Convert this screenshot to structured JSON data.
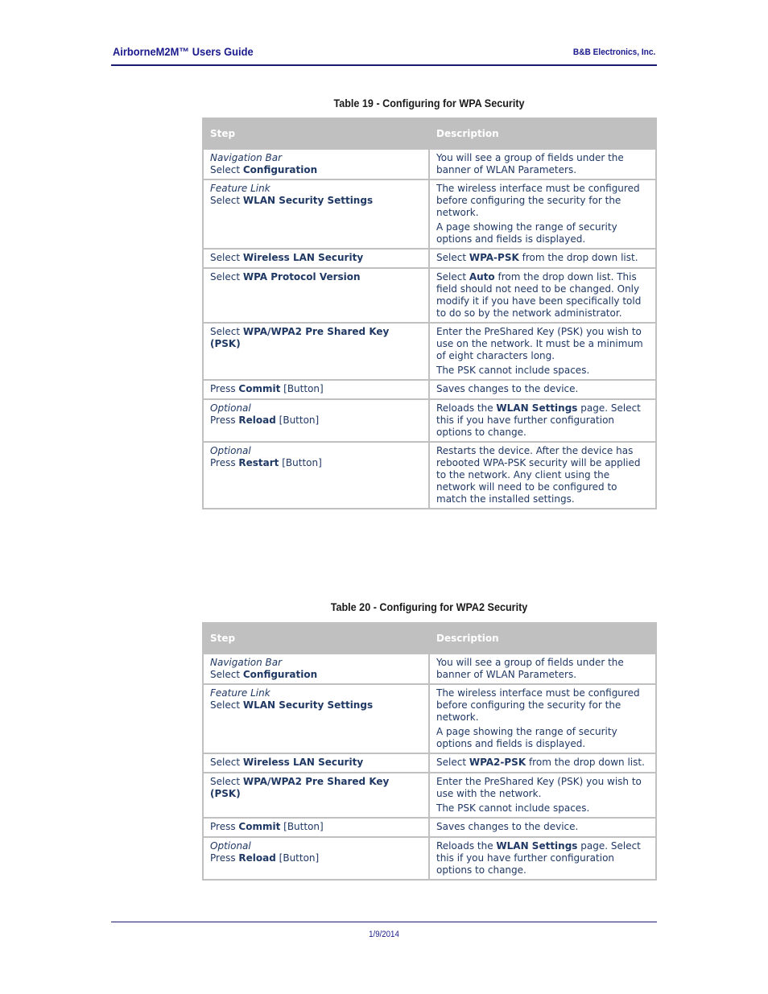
{
  "header": {
    "title": "AirborneM2M™ Users Guide",
    "company": "B&B Electronics, Inc."
  },
  "tables": [
    {
      "caption": "Table 19 - Configuring for WPA Security",
      "columns": [
        "Step",
        "Description"
      ],
      "rows": [
        {
          "step_context": "Navigation Bar",
          "step_prefix": "Select ",
          "step_bold": "Configuration",
          "step_suffix": "",
          "desc": [
            {
              "pre": "You will see a group of fields under the banner of WLAN Parameters.",
              "bold": "",
              "post": ""
            }
          ]
        },
        {
          "step_context": "Feature Link",
          "step_prefix": "Select ",
          "step_bold": "WLAN Security Settings",
          "step_suffix": "",
          "desc": [
            {
              "pre": "The wireless interface must be configured before configuring the security for the network.",
              "bold": "",
              "post": ""
            },
            {
              "pre": "A page showing the range of security options and fields is displayed.",
              "bold": "",
              "post": ""
            }
          ]
        },
        {
          "step_context": "",
          "step_prefix": "Select ",
          "step_bold": "Wireless LAN Security",
          "step_suffix": "",
          "desc": [
            {
              "pre": "Select ",
              "bold": "WPA-PSK",
              "post": " from the drop down list."
            }
          ]
        },
        {
          "step_context": "",
          "step_prefix": "Select ",
          "step_bold": "WPA Protocol Version",
          "step_suffix": "",
          "desc": [
            {
              "pre": "Select ",
              "bold": "Auto",
              "post": " from the drop down list. This field should not need to be changed. Only modify it if you have been specifically told to do so by the network administrator."
            }
          ]
        },
        {
          "step_context": "",
          "step_prefix": "Select ",
          "step_bold": "WPA/WPA2 Pre Shared Key (PSK)",
          "step_suffix": "",
          "desc": [
            {
              "pre": "Enter the PreShared Key (PSK) you wish to use on the network. It must be a minimum of eight characters long.",
              "bold": "",
              "post": ""
            },
            {
              "pre": "The PSK cannot include spaces.",
              "bold": "",
              "post": ""
            }
          ]
        },
        {
          "step_context": "",
          "step_prefix": "Press ",
          "step_bold": "Commit",
          "step_suffix": " [Button]",
          "desc": [
            {
              "pre": "Saves changes to the device.",
              "bold": "",
              "post": ""
            }
          ]
        },
        {
          "step_context": "Optional",
          "step_prefix": "Press ",
          "step_bold": "Reload",
          "step_suffix": " [Button]",
          "desc": [
            {
              "pre": "Reloads the ",
              "bold": "WLAN Settings",
              "post": " page. Select this if you have further configuration options to change."
            }
          ]
        },
        {
          "step_context": "Optional",
          "step_prefix": "Press ",
          "step_bold": "Restart",
          "step_suffix": " [Button]",
          "desc": [
            {
              "pre": "Restarts the device. After the device has rebooted WPA-PSK security will be applied to the network. Any client using the network will need to be configured to match the installed settings.",
              "bold": "",
              "post": ""
            }
          ]
        }
      ]
    },
    {
      "caption": "Table 20 - Configuring for WPA2 Security",
      "columns": [
        "Step",
        "Description"
      ],
      "rows": [
        {
          "step_context": "Navigation Bar",
          "step_prefix": "Select ",
          "step_bold": "Configuration",
          "step_suffix": "",
          "desc": [
            {
              "pre": "You will see a group of fields under the banner of WLAN Parameters.",
              "bold": "",
              "post": ""
            }
          ]
        },
        {
          "step_context": "Feature Link",
          "step_prefix": "Select ",
          "step_bold": "WLAN Security Settings",
          "step_suffix": "",
          "desc": [
            {
              "pre": "The wireless interface must be configured before configuring the security for the network.",
              "bold": "",
              "post": ""
            },
            {
              "pre": "A page showing the range of security options and fields is displayed.",
              "bold": "",
              "post": ""
            }
          ]
        },
        {
          "step_context": "",
          "step_prefix": "Select ",
          "step_bold": "Wireless LAN Security",
          "step_suffix": "",
          "desc": [
            {
              "pre": "Select ",
              "bold": "WPA2-PSK",
              "post": " from the drop down list."
            }
          ]
        },
        {
          "step_context": "",
          "step_prefix": "Select ",
          "step_bold": "WPA/WPA2 Pre Shared Key (PSK)",
          "step_suffix": "",
          "desc": [
            {
              "pre": "Enter the PreShared Key (PSK) you wish to use with the network.",
              "bold": "",
              "post": ""
            },
            {
              "pre": "The PSK cannot include spaces.",
              "bold": "",
              "post": ""
            }
          ]
        },
        {
          "step_context": "",
          "step_prefix": "Press ",
          "step_bold": "Commit",
          "step_suffix": " [Button]",
          "desc": [
            {
              "pre": "Saves changes to the device.",
              "bold": "",
              "post": ""
            }
          ]
        },
        {
          "step_context": "Optional",
          "step_prefix": "Press ",
          "step_bold": "Reload",
          "step_suffix": " [Button]",
          "desc": [
            {
              "pre": "Reloads the ",
              "bold": "WLAN Settings",
              "post": " page. Select this if you have further configuration options to change."
            }
          ]
        }
      ]
    }
  ],
  "footer": {
    "date": "1/9/2014"
  },
  "colors": {
    "header_navy": "#1a1a8c",
    "rule_navy": "#1a1a6e",
    "table_text": "#1f3864",
    "table_header_bg": "#c0c0c0",
    "table_header_text": "#ffffff",
    "table_border": "#c0c0c0"
  }
}
